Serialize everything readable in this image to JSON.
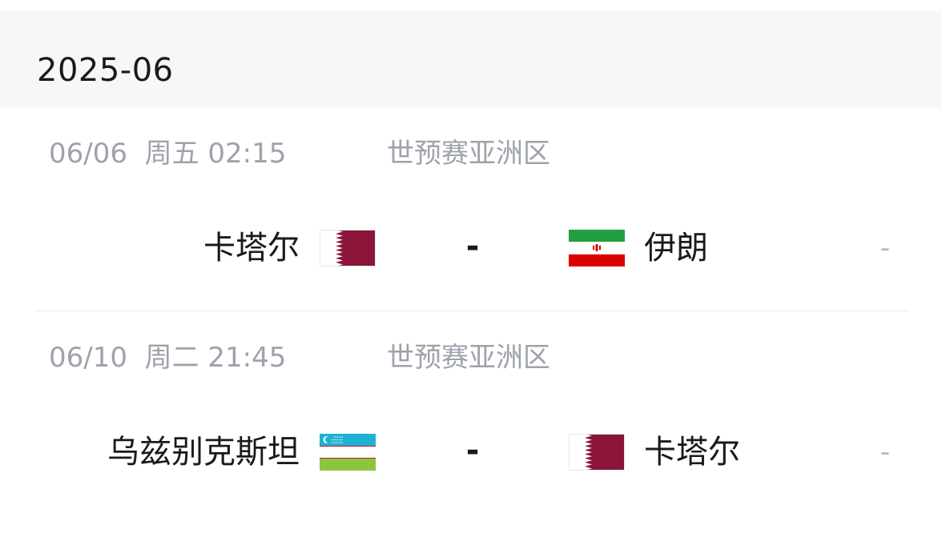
{
  "month": "2025-06",
  "matches": [
    {
      "date": "06/06",
      "weekday": "周五",
      "time": "02:15",
      "competition": "世预赛亚洲区",
      "home_team": "卡塔尔",
      "home_flag": "qatar-flag-icon",
      "score": "-",
      "away_team": "伊朗",
      "away_flag": "iran-flag-icon",
      "status": "-"
    },
    {
      "date": "06/10",
      "weekday": "周二",
      "time": "21:45",
      "competition": "世预赛亚洲区",
      "home_team": "乌兹别克斯坦",
      "home_flag": "uzbekistan-flag-icon",
      "score": "-",
      "away_team": "卡塔尔",
      "away_flag": "qatar-flag-icon",
      "status": "-"
    }
  ],
  "colors": {
    "header_bg": "#f6f7f9",
    "text_primary": "#1a1a1a",
    "text_secondary": "#9ea2ab",
    "qatar_maroon": "#8a1538",
    "iran_green": "#239f40",
    "iran_red": "#da0000",
    "uzbek_blue": "#1eb1d3",
    "uzbek_green": "#8cc63f"
  }
}
